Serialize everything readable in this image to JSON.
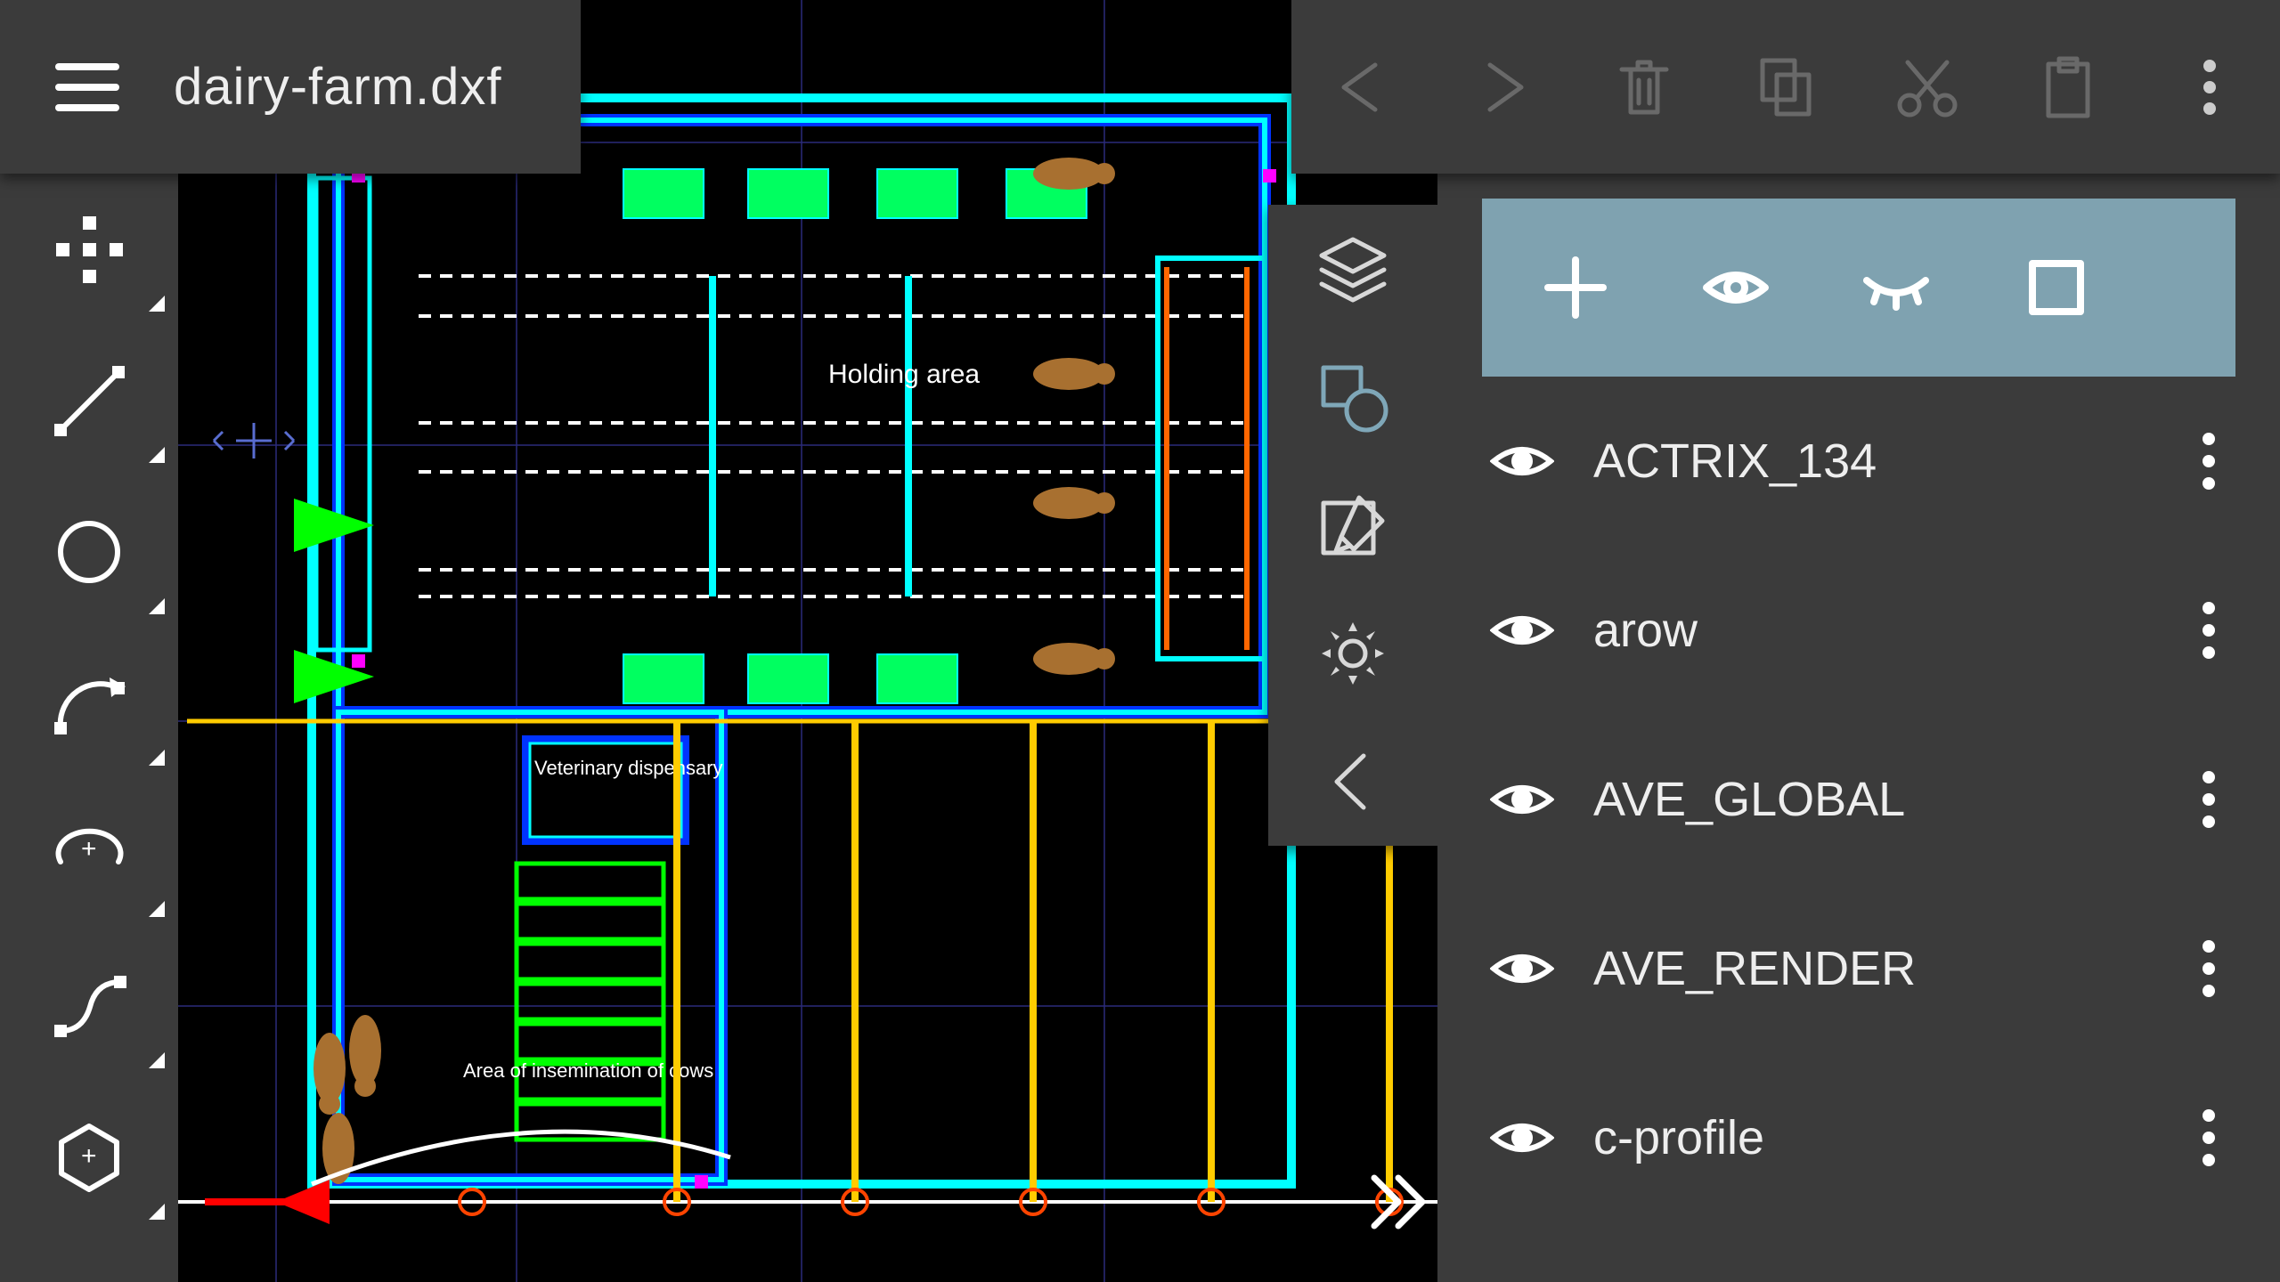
{
  "header": {
    "filename": "dairy-farm.dxf"
  },
  "drawing_labels": {
    "holding_area": "Holding area",
    "veterinary": "Veterinary dispensary",
    "insemination": "Area of insemination of cows"
  },
  "layers": [
    {
      "name": "ACTRIX_134",
      "visible": true
    },
    {
      "name": "arow",
      "visible": true
    },
    {
      "name": "AVE_GLOBAL",
      "visible": true
    },
    {
      "name": "AVE_RENDER",
      "visible": true
    },
    {
      "name": "c-profile",
      "visible": true
    }
  ],
  "colors": {
    "panel": "#3b3b3b",
    "accent": "#7fa2b0",
    "canvas_cyan": "#00ffff",
    "canvas_blue": "#0033ff",
    "canvas_green": "#00ff00",
    "canvas_yellow": "#ffcc00",
    "canvas_orange": "#ff6600",
    "canvas_red": "#ff0000",
    "canvas_magenta": "#ff00ff",
    "canvas_brown": "#a87030"
  }
}
